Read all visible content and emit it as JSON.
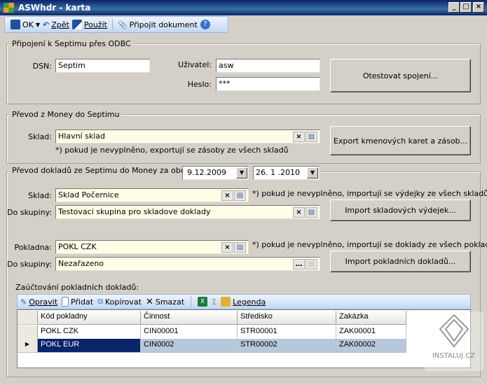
{
  "window": {
    "title": "ASWhdr - karta"
  },
  "toolbar": {
    "ok": "OK",
    "back": "Zpět",
    "apply": "Použít",
    "attach": "Připojit dokument"
  },
  "odbc": {
    "legend": "Připojení k Septimu přes ODBC",
    "dsn_label": "DSN:",
    "dsn": "Septim",
    "user_label": "Uživatel:",
    "user": "asw",
    "pass_label": "Heslo:",
    "pass": "***",
    "test_button": "Otestovat spojení..."
  },
  "export": {
    "legend": "Převod z Money do Septimu",
    "sklad_label": "Sklad:",
    "sklad": "Hlavní sklad",
    "note": "*) pokud je nevyplněno, exportují se zásoby ze všech skladů",
    "button": "Export kmenových karet a zásob..."
  },
  "import": {
    "legend": "Převod dokladů ze Septimu do Money za období",
    "date_from": "9.12.2009",
    "date_to": "26. 1 .2010",
    "sklad_label": "Sklad:",
    "sklad": "Sklad Počernice",
    "sklad_note": "*) pokud je nevyplněno, importují se výdejky ze všech skladů",
    "group_label": "Do skupiny:",
    "sklad_group": "Testovaci skupina pro skladove doklady",
    "sklad_button": "Import skladových výdejek...",
    "pokladna_label": "Pokladna:",
    "pokladna": "POKL CZK",
    "pokladna_note": "*) pokud je nevyplněno, importují se doklady ze všech pokladen",
    "pokladna_group": "Nezařazeno",
    "pokladna_button": "Import pokladních dokladů...",
    "posting_label": "Zaúčtování pokladních dokladů:"
  },
  "grid_toolbar": {
    "edit": "Opravit",
    "add": "Přidat",
    "copy": "Kopírovat",
    "delete": "Smazat",
    "legend": "Legenda",
    "sum": "Σ"
  },
  "grid": {
    "columns": [
      "Kód pokladny",
      "Činnost",
      "Středisko",
      "Zakázka"
    ],
    "rows": [
      [
        "POKL CZK",
        "CIN00001",
        "STR00001",
        "ZAK00001"
      ],
      [
        "POKL EUR",
        "CIN0002",
        "STR00002",
        "ZAK00002"
      ]
    ]
  },
  "watermark": "INSTALUJ.CZ"
}
